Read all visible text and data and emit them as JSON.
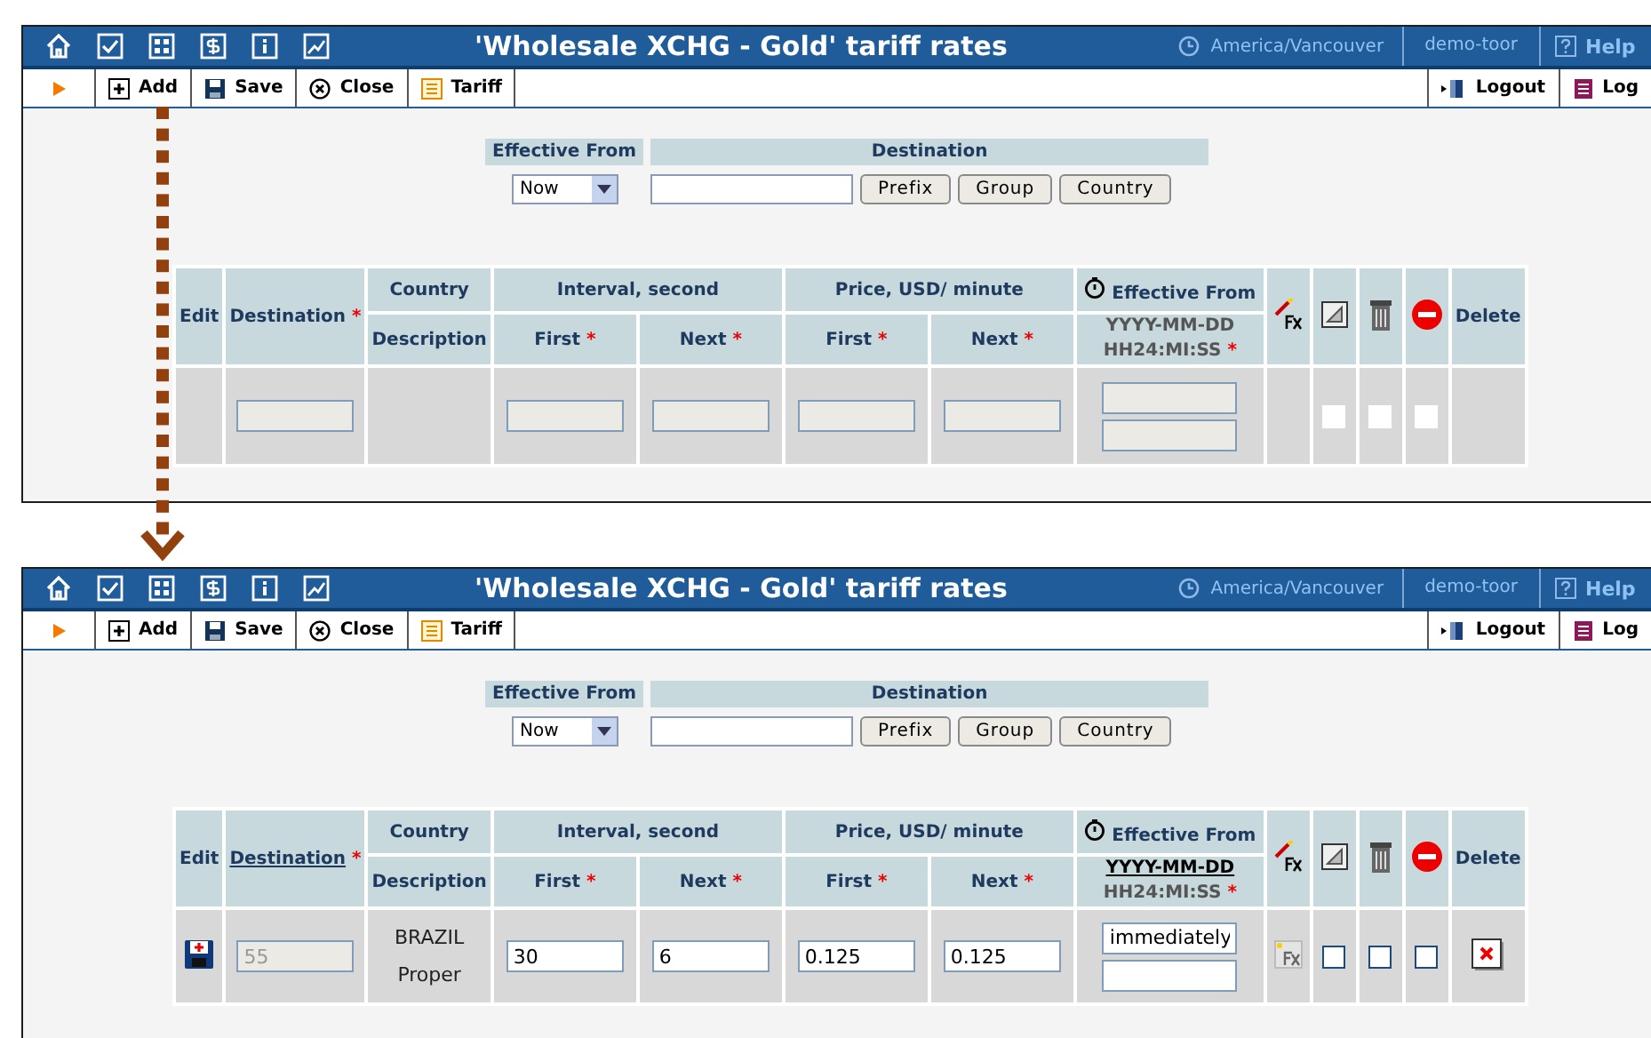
{
  "panels": [
    {
      "title": "'Wholesale XCHG - Gold' tariff rates",
      "timezone": "America/Vancouver",
      "user": "demo-toor",
      "help": "Help",
      "toolbar": [
        "Add",
        "Save",
        "Close",
        "Tariff"
      ],
      "toolbar_right": [
        "Logout",
        "Log"
      ],
      "filter": {
        "effective_label": "Effective From",
        "effective_value": "Now",
        "destination_label": "Destination",
        "buttons": [
          "Prefix",
          "Group",
          "Country"
        ]
      },
      "table": {
        "edit": "Edit",
        "destination": "Destination",
        "country": "Country",
        "description": "Description",
        "interval": "Interval, second",
        "price": "Price, USD/ minute",
        "interval_first": "First",
        "interval_next": "Next",
        "price_first": "First",
        "price_next": "Next",
        "effective": "Effective From",
        "date_format": "YYYY-MM-DD",
        "time_format": "HH24:MI:SS",
        "delete": "Delete",
        "required": "*",
        "sortable": false
      },
      "row": {
        "editing": false,
        "destination": {
          "disabled": true
        },
        "inputs": [
          {
            "disabled": true
          },
          {
            "disabled": true
          },
          {
            "disabled": true
          },
          {
            "disabled": true
          }
        ],
        "effective": [
          {
            "disabled": true
          },
          {
            "disabled": true
          }
        ],
        "checkboxes": [
          {
            "disabled": true
          },
          {
            "disabled": true
          },
          {
            "disabled": true
          }
        ]
      }
    },
    {
      "title": "'Wholesale XCHG - Gold' tariff rates",
      "timezone": "America/Vancouver",
      "user": "demo-toor",
      "help": "Help",
      "toolbar": [
        "Add",
        "Save",
        "Close",
        "Tariff"
      ],
      "toolbar_right": [
        "Logout",
        "Log"
      ],
      "filter": {
        "effective_label": "Effective From",
        "effective_value": "Now",
        "destination_label": "Destination",
        "buttons": [
          "Prefix",
          "Group",
          "Country"
        ]
      },
      "table": {
        "edit": "Edit",
        "destination": "Destination",
        "country": "Country",
        "description": "Description",
        "interval": "Interval, second",
        "price": "Price, USD/ minute",
        "interval_first": "First",
        "interval_next": "Next",
        "price_first": "First",
        "price_next": "Next",
        "effective": "Effective From",
        "date_format": "YYYY-MM-DD",
        "time_format": "HH24:MI:SS",
        "delete": "Delete",
        "required": "*",
        "sortable": true
      },
      "row": {
        "editing": true,
        "destination": {
          "value": "55",
          "disabled": true
        },
        "country": "BRAZIL",
        "description": "Proper",
        "inputs": [
          {
            "value": "30",
            "disabled": false
          },
          {
            "value": "6",
            "disabled": false
          },
          {
            "value": "0.125",
            "disabled": false
          },
          {
            "value": "0.125",
            "disabled": false
          }
        ],
        "effective": [
          {
            "value": "immediately",
            "disabled": false
          },
          {
            "disabled": false
          }
        ],
        "checkboxes": [
          {
            "disabled": false
          },
          {
            "disabled": false
          },
          {
            "disabled": false
          }
        ]
      }
    }
  ]
}
